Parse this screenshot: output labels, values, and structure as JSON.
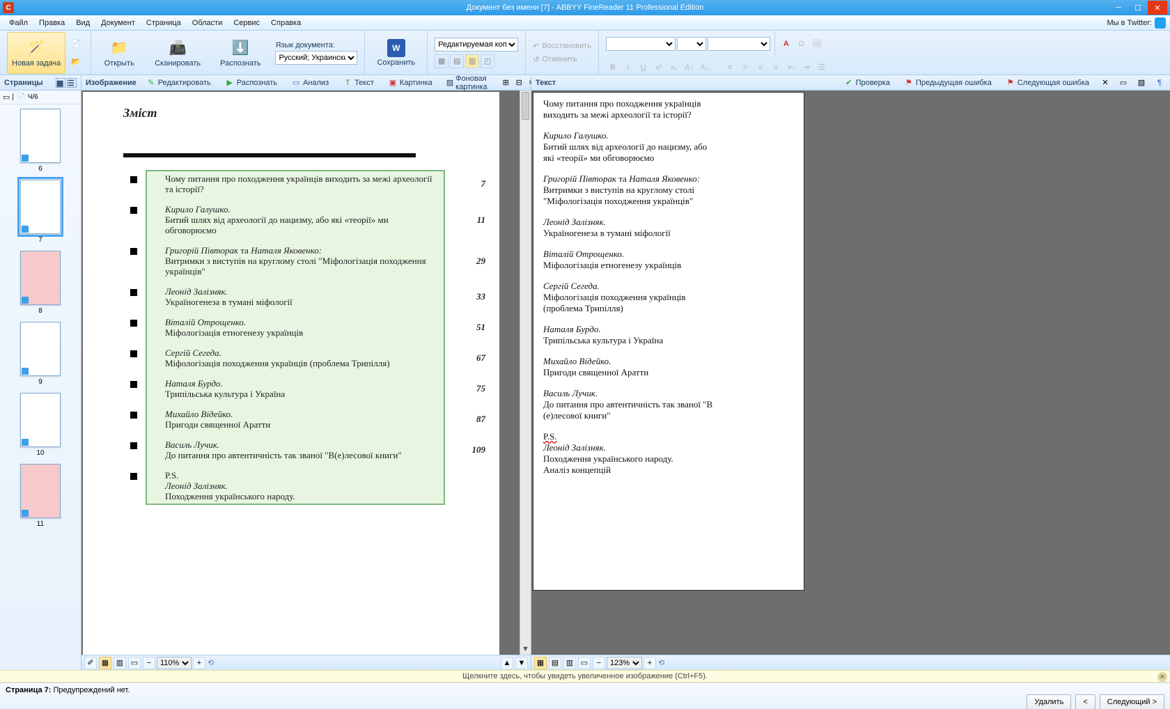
{
  "window": {
    "title": "Документ без имени [7] - ABBYY FineReader 11 Professional Edition",
    "app_icon_letter": "C"
  },
  "menu": {
    "items": [
      "Файл",
      "Правка",
      "Вид",
      "Документ",
      "Страница",
      "Области",
      "Сервис",
      "Справка"
    ],
    "twitter_label": "Мы в Twitter:"
  },
  "toolbar": {
    "new_task": "Новая задача",
    "open": "Открыть",
    "scan": "Сканировать",
    "recognize": "Распознать",
    "lang_label": "Язык документа:",
    "lang_value": "Русский; Украински",
    "save": "Сохранить",
    "layout_mode": "Редактируемая копи",
    "restore": "Восстановить",
    "undo": "Отменить"
  },
  "pages": {
    "header": "Страницы",
    "counter": "Ч/6",
    "items": [
      {
        "num": "6",
        "pink": false,
        "sel": false
      },
      {
        "num": "7",
        "pink": false,
        "sel": true
      },
      {
        "num": "8",
        "pink": true,
        "sel": false
      },
      {
        "num": "9",
        "pink": false,
        "sel": false
      },
      {
        "num": "10",
        "pink": false,
        "sel": false
      },
      {
        "num": "11",
        "pink": true,
        "sel": false
      }
    ]
  },
  "image_panel": {
    "header": "Изображение",
    "buttons": {
      "edit": "Редактировать",
      "recognize": "Распознать",
      "analyze": "Анализ",
      "text": "Текст",
      "picture": "Картинка",
      "bgpicture": "Фоновая картинка"
    },
    "zoom": "110%"
  },
  "doc": {
    "heading": "Зміст",
    "toc": [
      {
        "title": "Чому питання про походження українців виходить за межі археології та історії?",
        "page": "7"
      },
      {
        "author": "Кирило Галушко.",
        "title": "Битий шлях від археології до нацизму, або які «теорії» ми обговорюємо",
        "page": "11"
      },
      {
        "author": "Григорій Півторак",
        "conj": " та ",
        "author2": "Наталя Яковенко:",
        "title": "Витримки з виступів на круглому столі \"Міфологізація походження українців\"",
        "page": "29"
      },
      {
        "author": "Леонід Залізняк.",
        "title": "Україногенеза в тумані міфології",
        "page": "33"
      },
      {
        "author": "Віталій Отрощенко.",
        "title": "Міфологізація етногенезу українців",
        "page": "51"
      },
      {
        "author": "Сергій Сегеда.",
        "title": "Міфологізація походження українців (проблема Трипілля)",
        "page": "67"
      },
      {
        "author": "Наталя Бурдо.",
        "title": "Трипільська культура і Україна",
        "page": "75"
      },
      {
        "author": "Михайло Відейко.",
        "title": "Пригоди священної Аратти",
        "page": "87"
      },
      {
        "author": "Василь Лучик.",
        "title": "До питання про автентичність так званої \"В(е)лесової книги\"",
        "page": "109"
      },
      {
        "ps": "P.S.",
        "author": "Леонід Залізняк.",
        "title": "Походження українського народу."
      }
    ]
  },
  "text_panel": {
    "header": "Текст",
    "buttons": {
      "check": "Проверка",
      "prev": "Предыдущая ошибка",
      "next": "Следующая ошибка"
    },
    "zoom": "123%",
    "paragraphs": [
      {
        "lines": [
          "Чому питання про походження українців",
          "виходить за межі археології та історії?"
        ]
      },
      {
        "author": "Кирило Галушко.",
        "lines": [
          "Битий шлях від археології до нацизму, або",
          "які «теорії» ми обговорюємо"
        ]
      },
      {
        "author": "Григорій Півторак",
        "conj": " та ",
        "author2": "Наталя Яковенко:",
        "lines": [
          "Витримки з виступів на круглому столі",
          "\"Міфологізація походження українців\""
        ]
      },
      {
        "author": "Леонід Залізняк.",
        "lines": [
          "Україногенеза в тумані міфології"
        ]
      },
      {
        "author": "Віталій Отрощенко.",
        "lines": [
          "Міфологізація етногенезу українців"
        ]
      },
      {
        "author": "Сергій Сегеда.",
        "lines": [
          "Міфологізація походження українців",
          "(проблема Трипілля)"
        ]
      },
      {
        "author": "Наталя Бурдо.",
        "lines": [
          "Трипільська культура і Україна"
        ]
      },
      {
        "author": "Михайло Відейко.",
        "lines": [
          "Пригоди священної Аратти"
        ]
      },
      {
        "author": "Василь Лучик.",
        "lines": [
          "До питання про автентичність так званої \"В",
          "(е)лесової книги\""
        ]
      },
      {
        "ps": "P.S.",
        "author": "Леонід Залізняк.",
        "lines": [
          "Походження українського народу.",
          "Аналіз концепцій"
        ]
      }
    ]
  },
  "hint": "Щелкните здесь, чтобы увидеть увеличенное изображение (Ctrl+F5).",
  "status": {
    "page_label": "Страница 7:",
    "warnings": "Предупреждений нет.",
    "delete": "Удалить",
    "prev": "<",
    "next": "Следующий >"
  }
}
